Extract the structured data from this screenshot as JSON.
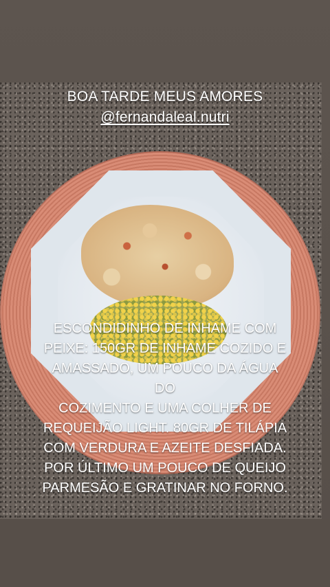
{
  "story": {
    "greeting": "BOA TARDE MEUS AMORES",
    "handle": "@fernandaleal.nutri",
    "recipe_text": "ESCONDIDINHO DE INHAME COM\nPEIXE: 150GR DE INHAME COZIDO E\nAMASSADO, UM POUCO DA ÁGUA DO\nCOZIMENTO E UMA COLHER DE\nREQUEIJÃO LIGHT. 80GR  DE TILÁPIA\nCOM VERDURA E AZEITE DESFIADA.\nPOR ÚLTIMO  UM POUCO DE QUEIJO\nPARMESÃO  E GRATINAR NO FORNO."
  },
  "colors": {
    "background": "#5b534d",
    "placemat": "#d98c76",
    "plate": "#dfe6ec",
    "text": "#ffffff"
  }
}
